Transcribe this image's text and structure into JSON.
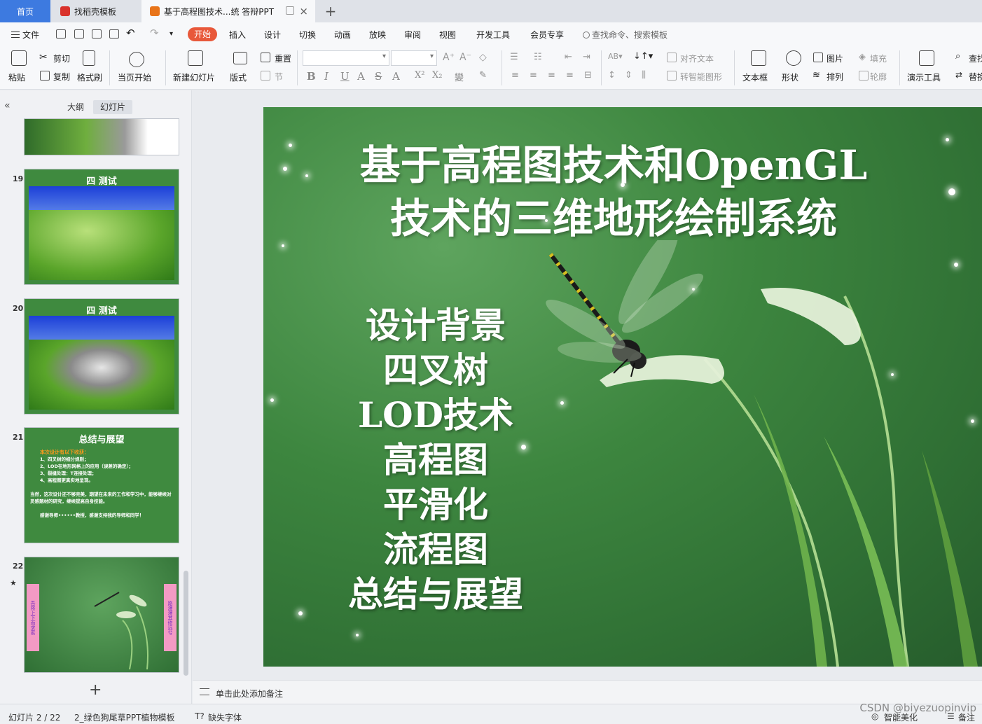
{
  "tabs": {
    "home": "首页",
    "template": "找稻壳模板",
    "document": "基于高程图技术...统 答辩PPT"
  },
  "menu": {
    "file": "文件",
    "start": "开始",
    "insert": "插入",
    "design": "设计",
    "transition": "切换",
    "animation": "动画",
    "slideshow": "放映",
    "review": "审阅",
    "view": "视图",
    "devtools": "开发工具",
    "member": "会员专享",
    "search": "查找命令、搜索模板"
  },
  "ribbon": {
    "paste": "粘贴",
    "cut": "剪切",
    "copy": "复制",
    "format_painter": "格式刷",
    "from_current": "当页开始",
    "new_slide": "新建幻灯片",
    "layout": "版式",
    "reset": "重置",
    "section": "节",
    "align_text": "对齐文本",
    "smartart": "转智能图形",
    "textbox": "文本框",
    "shape": "形状",
    "picture": "图片",
    "fill": "填充",
    "arrange": "排列",
    "outline": "轮廓",
    "present_tools": "演示工具",
    "find": "查找",
    "replace": "替换"
  },
  "panel": {
    "outline_tab": "大纲",
    "slides_tab": "幻灯片"
  },
  "thumbnails": [
    {
      "num": "19",
      "title": "四 测试"
    },
    {
      "num": "20",
      "title": "四 测试"
    },
    {
      "num": "21",
      "title": "总结与展望",
      "lines": [
        "本次设计有以下收获：",
        "1、四叉树的细分规则；",
        "2、LOD在地形网格上的应用（误差的确定）；",
        "3、裂缝处理：T连接处理；",
        "4、高程图更真实地呈现。",
        "当然，这次设计还不够完美，期望在未来的工作和学习中，能够继续对灵感题材的研究，继续提高自身技能。",
        "感谢导师••••••教授，感谢支持我的导师和同学！"
      ]
    },
    {
      "num": "22",
      "left_band": "吾将上下而求索",
      "right_band": "路漫漫其修远兮"
    }
  ],
  "slide": {
    "title_line1": "基于高程图技术和OpenGL",
    "title_line2": "技术的三维地形绘制系统",
    "toc": [
      "设计背景",
      "四叉树",
      "LOD技术",
      "高程图",
      "平滑化",
      "流程图",
      "总结与展望"
    ]
  },
  "notes": {
    "placeholder": "单击此处添加备注"
  },
  "status": {
    "slide_index": "幻灯片 2 / 22",
    "template_name": "2_绿色狗尾草PPT植物模板",
    "missing_font": "缺失字体",
    "beautify": "智能美化",
    "notes": "备注"
  },
  "watermark": "CSDN @biyezuopinvip",
  "colors": {
    "accent": "#3d7ae0",
    "start_tab": "#e8583a",
    "slide_green": "#3d863f"
  }
}
